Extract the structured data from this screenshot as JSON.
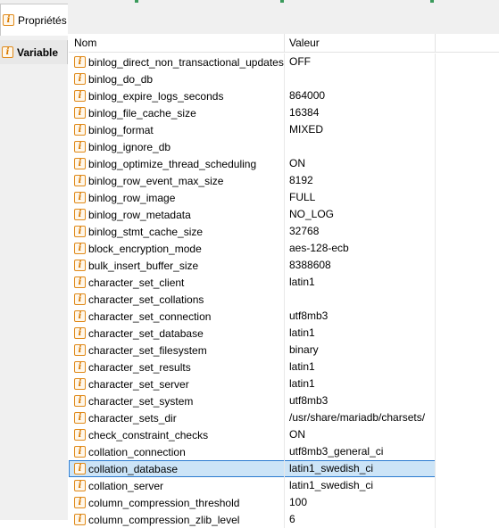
{
  "tabs": [
    {
      "label": "Propriétés",
      "icon": "info-icon"
    },
    {
      "label": "Variable",
      "icon": "info-icon"
    }
  ],
  "columns": {
    "name": "Nom",
    "value": "Valeur"
  },
  "selected_row": "collation_database",
  "rows": [
    {
      "name": "binlog_direct_non_transactional_updates",
      "value": "OFF"
    },
    {
      "name": "binlog_do_db",
      "value": ""
    },
    {
      "name": "binlog_expire_logs_seconds",
      "value": "864000"
    },
    {
      "name": "binlog_file_cache_size",
      "value": "16384"
    },
    {
      "name": "binlog_format",
      "value": "MIXED"
    },
    {
      "name": "binlog_ignore_db",
      "value": ""
    },
    {
      "name": "binlog_optimize_thread_scheduling",
      "value": "ON"
    },
    {
      "name": "binlog_row_event_max_size",
      "value": "8192"
    },
    {
      "name": "binlog_row_image",
      "value": "FULL"
    },
    {
      "name": "binlog_row_metadata",
      "value": "NO_LOG"
    },
    {
      "name": "binlog_stmt_cache_size",
      "value": "32768"
    },
    {
      "name": "block_encryption_mode",
      "value": "aes-128-ecb"
    },
    {
      "name": "bulk_insert_buffer_size",
      "value": "8388608"
    },
    {
      "name": "character_set_client",
      "value": "latin1"
    },
    {
      "name": "character_set_collations",
      "value": ""
    },
    {
      "name": "character_set_connection",
      "value": "utf8mb3"
    },
    {
      "name": "character_set_database",
      "value": "latin1"
    },
    {
      "name": "character_set_filesystem",
      "value": "binary"
    },
    {
      "name": "character_set_results",
      "value": "latin1"
    },
    {
      "name": "character_set_server",
      "value": "latin1"
    },
    {
      "name": "character_set_system",
      "value": "utf8mb3"
    },
    {
      "name": "character_sets_dir",
      "value": "/usr/share/mariadb/charsets/"
    },
    {
      "name": "check_constraint_checks",
      "value": "ON"
    },
    {
      "name": "collation_connection",
      "value": "utf8mb3_general_ci"
    },
    {
      "name": "collation_database",
      "value": "latin1_swedish_ci"
    },
    {
      "name": "collation_server",
      "value": "latin1_swedish_ci"
    },
    {
      "name": "column_compression_threshold",
      "value": "100"
    },
    {
      "name": "column_compression_zlib_level",
      "value": "6"
    }
  ]
}
